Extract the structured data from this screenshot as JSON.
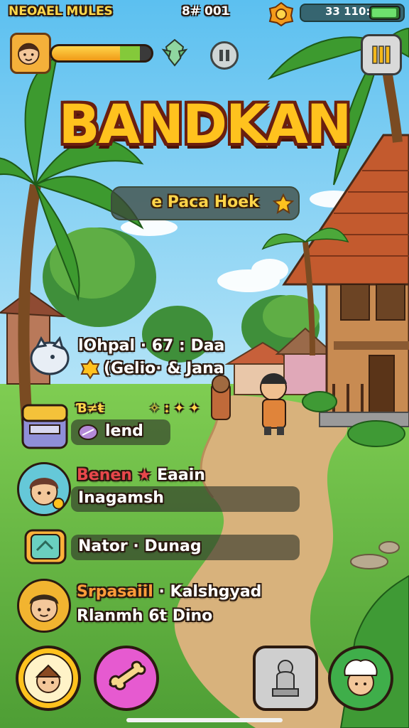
{
  "hud": {
    "top_left_label": "NEOAEL MULES",
    "score_readout": "8# 001",
    "battery_text": "33 110:",
    "xp_progress": 0.78
  },
  "title": {
    "main": "BANDKAN",
    "subtitle": "e Paca Hoek"
  },
  "quests": {
    "item1_line1": "lOhpal · 67 : Daa",
    "item1_line2": "(Gelio· & Jana",
    "item2_header": "Ɓ≠ŧ",
    "item2_icons": "✧ ꞉ ✦ ✦",
    "item2_label": "lend",
    "item3_name_a": "Benen",
    "item3_name_sep": " ★ ",
    "item3_name_b": "Eaain",
    "item3_sub": "Inagamsh",
    "item4_label": "Nator · Dunag",
    "item5_name_a": "Srpasaiil",
    "item5_name_b": " · Kalshgyad",
    "item5_sub": "Rlanmh 6t Dino"
  },
  "colors": {
    "accent_gold": "#ffc21e",
    "name_red": "#e8474b",
    "name_orange": "#ff9d3a",
    "sky": "#8fd3f5",
    "grass": "#6cc04a",
    "path": "#d8b27c"
  }
}
